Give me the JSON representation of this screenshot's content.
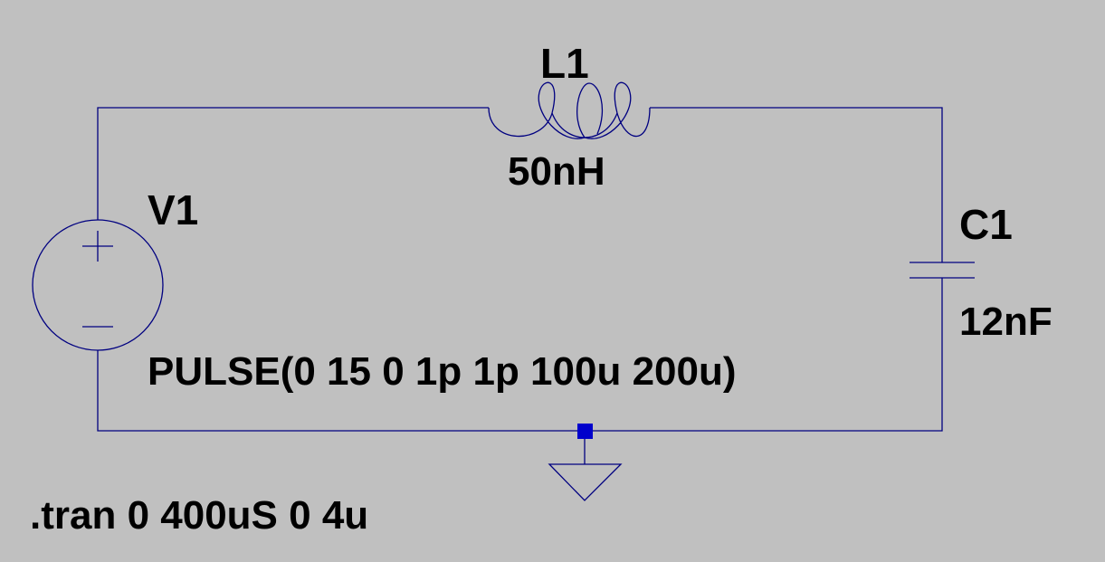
{
  "canvas": {
    "background": "#c0c0c0",
    "wire_color": "#000080",
    "junction_color": "#0000cc"
  },
  "components": {
    "inductor": {
      "name": "L1",
      "value": "50nH"
    },
    "source": {
      "name": "V1",
      "value": "PULSE(0 15 0 1p 1p 100u 200u)"
    },
    "capacitor": {
      "name": "C1",
      "value": "12nF"
    }
  },
  "directive": {
    "text": ".tran 0 400uS 0 4u"
  }
}
